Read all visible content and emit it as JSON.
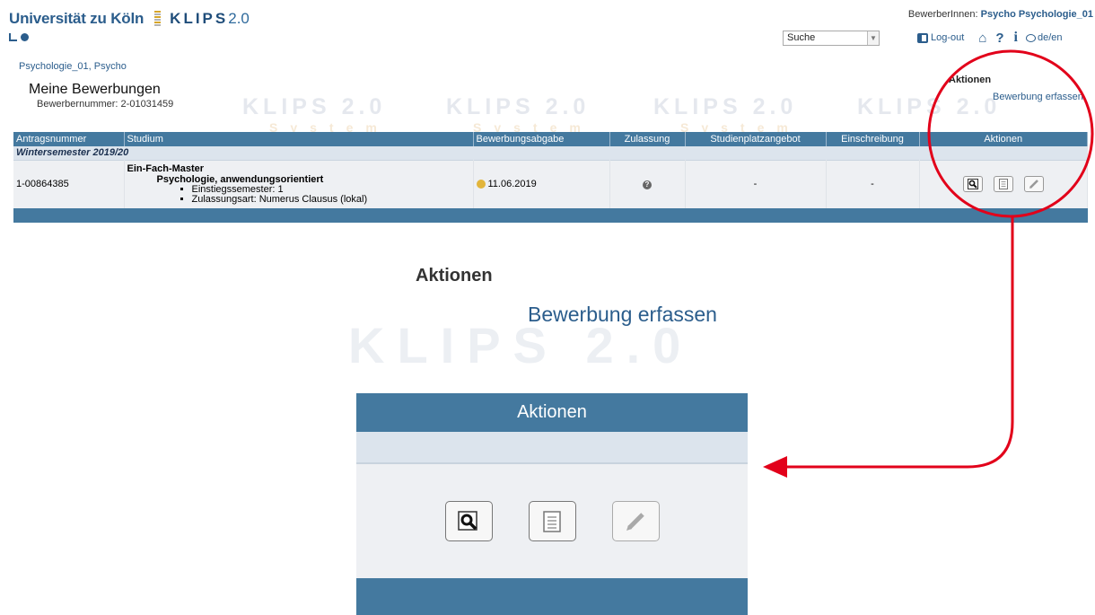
{
  "header": {
    "university": "Universität zu Köln",
    "klips": "KLIPS",
    "klips_version": "2.0",
    "user_label": "BewerberInnen:",
    "user_name": "Psycho Psychologie_01",
    "search_placeholder": "Suche",
    "logout": "Log-out",
    "language": "de/en"
  },
  "watermark": {
    "text": "KLIPS 2.0",
    "sub": "System"
  },
  "breadcrumb": "Psychologie_01, Psycho",
  "page": {
    "title": "Meine Bewerbungen",
    "applicant_number_label": "Bewerbernummer:",
    "applicant_number": "2-01031459"
  },
  "actions_box": {
    "heading": "Aktionen",
    "link": "Bewerbung erfassen"
  },
  "table": {
    "columns": [
      "Antragsnummer",
      "Studium",
      "Bewerbungsabgabe",
      "Zulassung",
      "Studienplatzangebot",
      "Einschreibung",
      "Aktionen"
    ],
    "semester": "Wintersemester 2019/20",
    "row": {
      "number": "1-00864385",
      "degree": "Ein-Fach-Master",
      "subject": "Psychologie, anwendungsorientiert",
      "detail_1": "Einstiegssemester: 1",
      "detail_2": "Zulassungsart: Numerus Clausus (lokal)",
      "submitted": "11.06.2019",
      "offer": "-",
      "enrollment": "-"
    }
  },
  "zoom": {
    "heading": "Aktionen",
    "link": "Bewerbung erfassen",
    "table_header": "Aktionen"
  },
  "colors": {
    "brand": "#2b5d8c",
    "table_header": "#44799f",
    "annotation": "#e2001a"
  },
  "icons": [
    "external-link-icon",
    "circle-arrow-icon",
    "logout-icon",
    "home-icon",
    "help-icon",
    "info-icon",
    "speech-bubble-icon",
    "view-icon",
    "document-icon",
    "edit-icon",
    "status-warning-icon",
    "status-question-icon"
  ]
}
